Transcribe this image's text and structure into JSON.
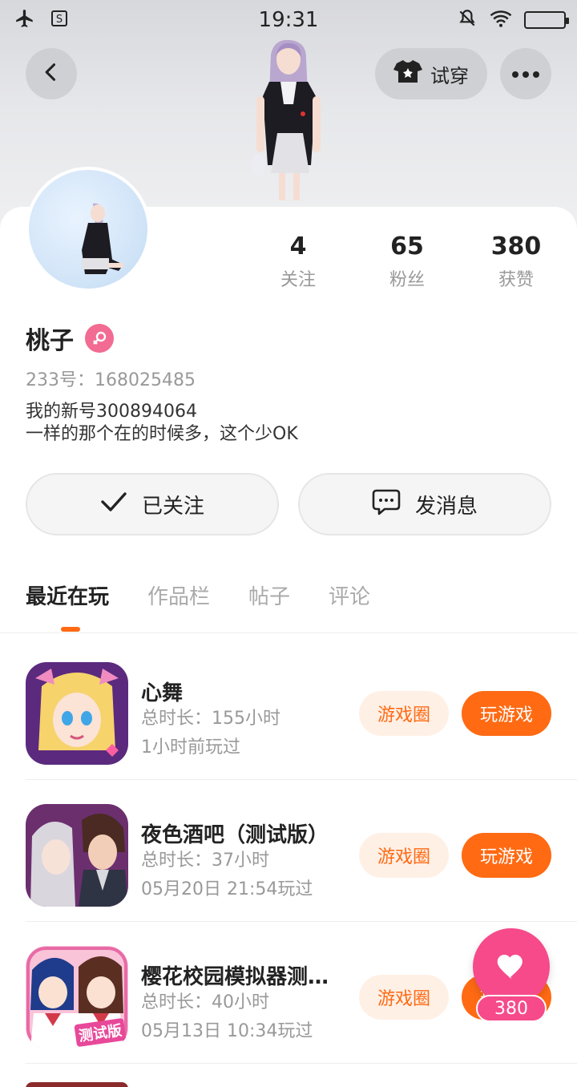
{
  "status_bar": {
    "time": "19:31",
    "left_icons": [
      "airplane-icon",
      "s-app-icon"
    ],
    "right_icons": [
      "mute-icon",
      "wifi-icon",
      "battery-icon"
    ]
  },
  "header": {
    "try_on_label": "试穿",
    "back_icon": "chevron-left-icon",
    "more_icon": "more-icon",
    "shirt_icon": "shirt-icon"
  },
  "profile": {
    "name": "桃子",
    "gender": "female",
    "uid_label": "233号：168025485",
    "bio_line1": "我的新号300894064",
    "bio_line2": "一样的那个在的时候多，这个少OK"
  },
  "stats": [
    {
      "value": "4",
      "label": "关注"
    },
    {
      "value": "65",
      "label": "粉丝"
    },
    {
      "value": "380",
      "label": "获赞"
    }
  ],
  "actions": {
    "follow_label": "已关注",
    "message_label": "发消息"
  },
  "tabs": [
    {
      "label": "最近在玩",
      "active": true
    },
    {
      "label": "作品栏",
      "active": false
    },
    {
      "label": "帖子",
      "active": false
    },
    {
      "label": "评论",
      "active": false
    }
  ],
  "games": [
    {
      "title": "心舞",
      "duration": "总时长：155小时",
      "last_played": "1小时前玩过",
      "circle_label": "游戏圈",
      "play_label": "玩游戏"
    },
    {
      "title": "夜色酒吧（测试版）",
      "duration": "总时长：37小时",
      "last_played": "05月20日 21:54玩过",
      "circle_label": "游戏圈",
      "play_label": "玩游戏"
    },
    {
      "title": "樱花校园模拟器测…",
      "duration": "总时长：40小时",
      "last_played": "05月13日 10:34玩过",
      "circle_label": "游戏圈",
      "play_label": "玩游戏"
    }
  ],
  "game_icon_badge": "测试版",
  "like_fab": {
    "count": "380"
  },
  "colors": {
    "accent": "#ff6a13",
    "accent_light": "#fff0e6",
    "pink": "#f64a8a",
    "gender_pink": "#f26b93"
  }
}
